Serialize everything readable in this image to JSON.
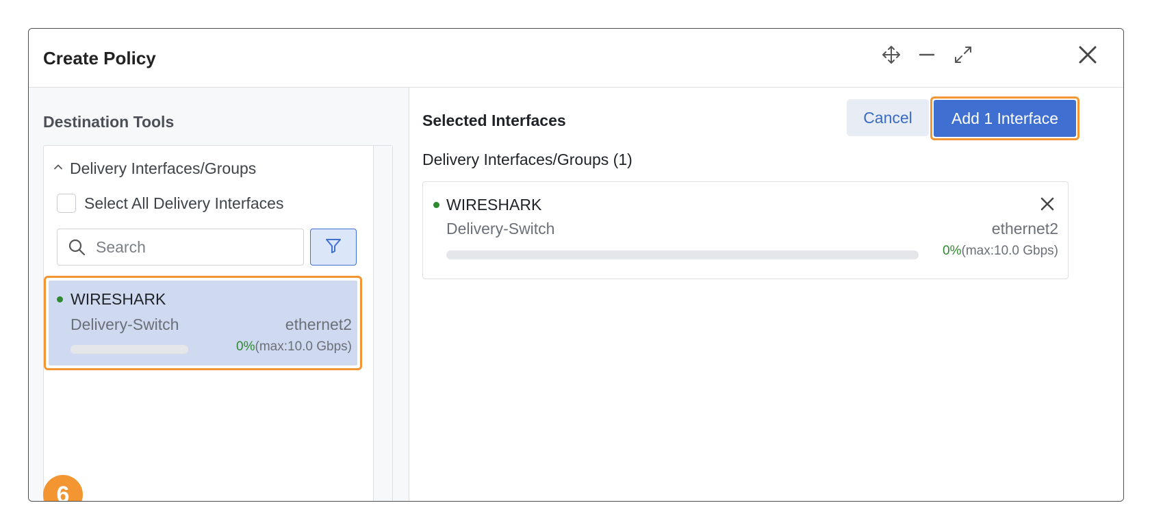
{
  "dialog": {
    "title": "Create Policy",
    "header_icons": [
      "move-icon",
      "minimize-icon",
      "expand-icon",
      "close-icon"
    ]
  },
  "left": {
    "section_title": "Destination Tools",
    "group_label": "Delivery Interfaces/Groups",
    "select_all_label": "Select All Delivery Interfaces",
    "search": {
      "placeholder": "Search",
      "value": ""
    },
    "interface": {
      "name": "WIRESHARK",
      "switch": "Delivery-Switch",
      "port": "ethernet2",
      "usage_pct": "0%",
      "usage_max": "(max:10.0 Gbps)",
      "usage_fraction": 0
    },
    "step_badge": "6"
  },
  "right": {
    "title": "Selected Interfaces",
    "cancel_label": "Cancel",
    "add_label": "Add 1 Interface",
    "group_count_label": "Delivery Interfaces/Groups (1)",
    "interface": {
      "name": "WIRESHARK",
      "switch": "Delivery-Switch",
      "port": "ethernet2",
      "usage_pct": "0%",
      "usage_max": "(max:10.0 Gbps)",
      "usage_fraction": 0
    }
  },
  "colors": {
    "accent_blue": "#3f6fd0",
    "highlight_orange": "#f39530",
    "status_green": "#2f8a2f",
    "selected_row_bg": "#cfdaf1"
  }
}
